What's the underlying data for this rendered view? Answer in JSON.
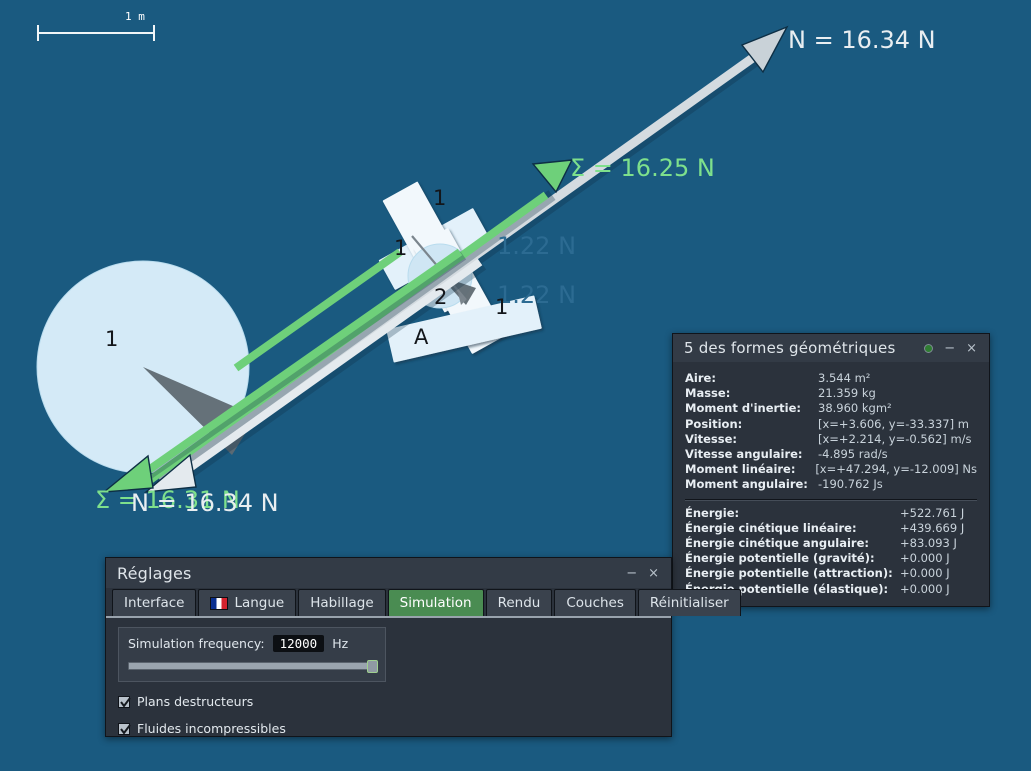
{
  "scene": {
    "background_color": "#1a5a80",
    "scale_bar": {
      "label": "1 m"
    },
    "vector_labels": [
      {
        "id": "normal_top",
        "text": "N = 16.34 N",
        "color": "#e9eef1",
        "style": "white"
      },
      {
        "id": "sum_top",
        "text": "Σ = 16.25 N",
        "color": "#7ee08c",
        "style": "green"
      },
      {
        "id": "faint_upper",
        "text": "1.22 N",
        "color": "#2c6b92",
        "style": "faint"
      },
      {
        "id": "faint_lower",
        "text": "1.22 N",
        "color": "#2c6b92",
        "style": "faint"
      },
      {
        "id": "sum_bottom",
        "text": "Σ = 16.31 N",
        "color": "#7ee08c",
        "style": "green"
      },
      {
        "id": "normal_bottom",
        "text": "N = 16.34 N",
        "color": "#e9eef1",
        "style": "white"
      }
    ],
    "shape_labels": [
      {
        "id": "big-circle",
        "text": "1"
      },
      {
        "id": "rect-upper",
        "text": "1"
      },
      {
        "id": "rect-left",
        "text": "1"
      },
      {
        "id": "small-circle",
        "text": "2"
      },
      {
        "id": "rect-right",
        "text": "1"
      },
      {
        "id": "rect-bottom",
        "text": "A"
      }
    ]
  },
  "info_panel": {
    "title": "5 des formes géométriques",
    "buttons": {
      "pin": "●",
      "minimize": "−",
      "close": "×"
    },
    "properties": [
      {
        "key": "Aire:",
        "value": "3.544 m²"
      },
      {
        "key": "Masse:",
        "value": "21.359 kg"
      },
      {
        "key": "Moment d'inertie:",
        "value": "38.960 kgm²"
      },
      {
        "key": "Position:",
        "value": "[x=+3.606, y=-33.337] m"
      },
      {
        "key": "Vitesse:",
        "value": "[x=+2.214, y=-0.562] m/s"
      },
      {
        "key": "Vitesse angulaire:",
        "value": "-4.895 rad/s"
      },
      {
        "key": "Moment linéaire:",
        "value": "[x=+47.294, y=-12.009] Ns"
      },
      {
        "key": "Moment angulaire:",
        "value": "-190.762 Js"
      }
    ],
    "energies": [
      {
        "key": "Énergie:",
        "value": "+522.761 J"
      },
      {
        "key": "Énergie cinétique linéaire:",
        "value": "+439.669 J"
      },
      {
        "key": "Énergie cinétique angulaire:",
        "value": "+83.093 J"
      },
      {
        "key": "Énergie potentielle (gravité):",
        "value": "+0.000 J"
      },
      {
        "key": "Énergie potentielle (attraction):",
        "value": "+0.000 J"
      },
      {
        "key": "Énergie potentielle (élastique):",
        "value": "+0.000 J"
      }
    ]
  },
  "settings_dialog": {
    "title": "Réglages",
    "buttons": {
      "minimize": "−",
      "close": "×"
    },
    "tabs": [
      {
        "label": "Interface",
        "active": false,
        "icon": null
      },
      {
        "label": "Langue",
        "active": false,
        "icon": "french-flag-icon"
      },
      {
        "label": "Habillage",
        "active": false,
        "icon": null
      },
      {
        "label": "Simulation",
        "active": true,
        "icon": null
      },
      {
        "label": "Rendu",
        "active": false,
        "icon": null
      },
      {
        "label": "Couches",
        "active": false,
        "icon": null
      },
      {
        "label": "Réinitialiser",
        "active": false,
        "icon": null
      }
    ],
    "active_tab_color": "#4a8c52",
    "frequency": {
      "label": "Simulation frequency:",
      "value": "12000",
      "unit": "Hz",
      "slider_percent": 100
    },
    "checkboxes": [
      {
        "label": "Plans destructeurs",
        "checked": true
      },
      {
        "label": "Fluides incompressibles",
        "checked": true
      }
    ]
  }
}
